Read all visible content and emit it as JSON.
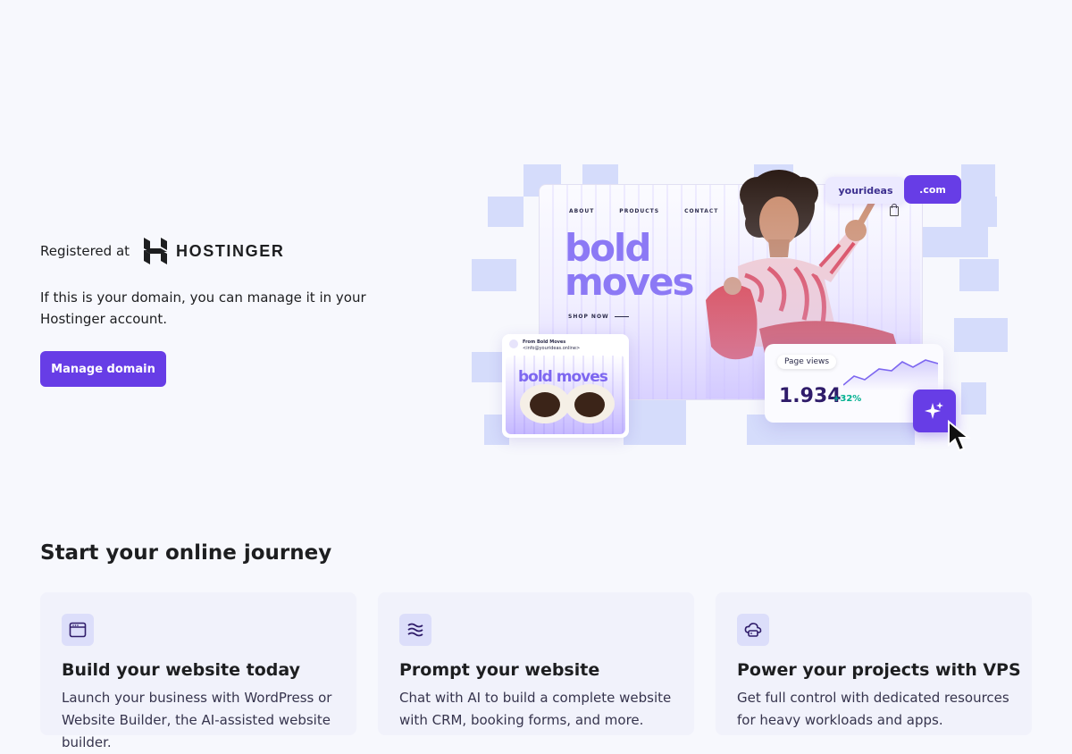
{
  "hero": {
    "registered_label": "Registered at",
    "brand_name": "HOSTINGER",
    "description": "If this is your domain, you can manage it in your Hostinger account.",
    "cta_label": "Manage domain",
    "accent_color": "#673de6"
  },
  "illustration": {
    "nav": [
      "ABOUT",
      "PRODUCTS",
      "CONTACT"
    ],
    "headline_line1": "bold",
    "headline_line2": "moves",
    "shop_now": "SHOP NOW",
    "domain_name": "yourideas",
    "domain_tld": ".com",
    "email": {
      "from": "From Bold Moves",
      "address": "<info@yourideas.online>",
      "banner": "bold moves"
    },
    "stats": {
      "label": "Page views",
      "value": "1.934",
      "delta": "+32%"
    }
  },
  "journey": {
    "title": "Start your online journey",
    "cards": [
      {
        "icon": "browser-window-icon",
        "title": "Build your website today",
        "description": "Launch your business with WordPress or Website Builder, the AI-assisted website builder."
      },
      {
        "icon": "sliders-icon",
        "title": "Prompt your website",
        "description": "Chat with AI to build a complete website with CRM, booking forms, and more."
      },
      {
        "icon": "cloud-server-icon",
        "title": "Power your projects with VPS",
        "description": "Get full control with dedicated resources for heavy workloads and apps."
      }
    ]
  }
}
